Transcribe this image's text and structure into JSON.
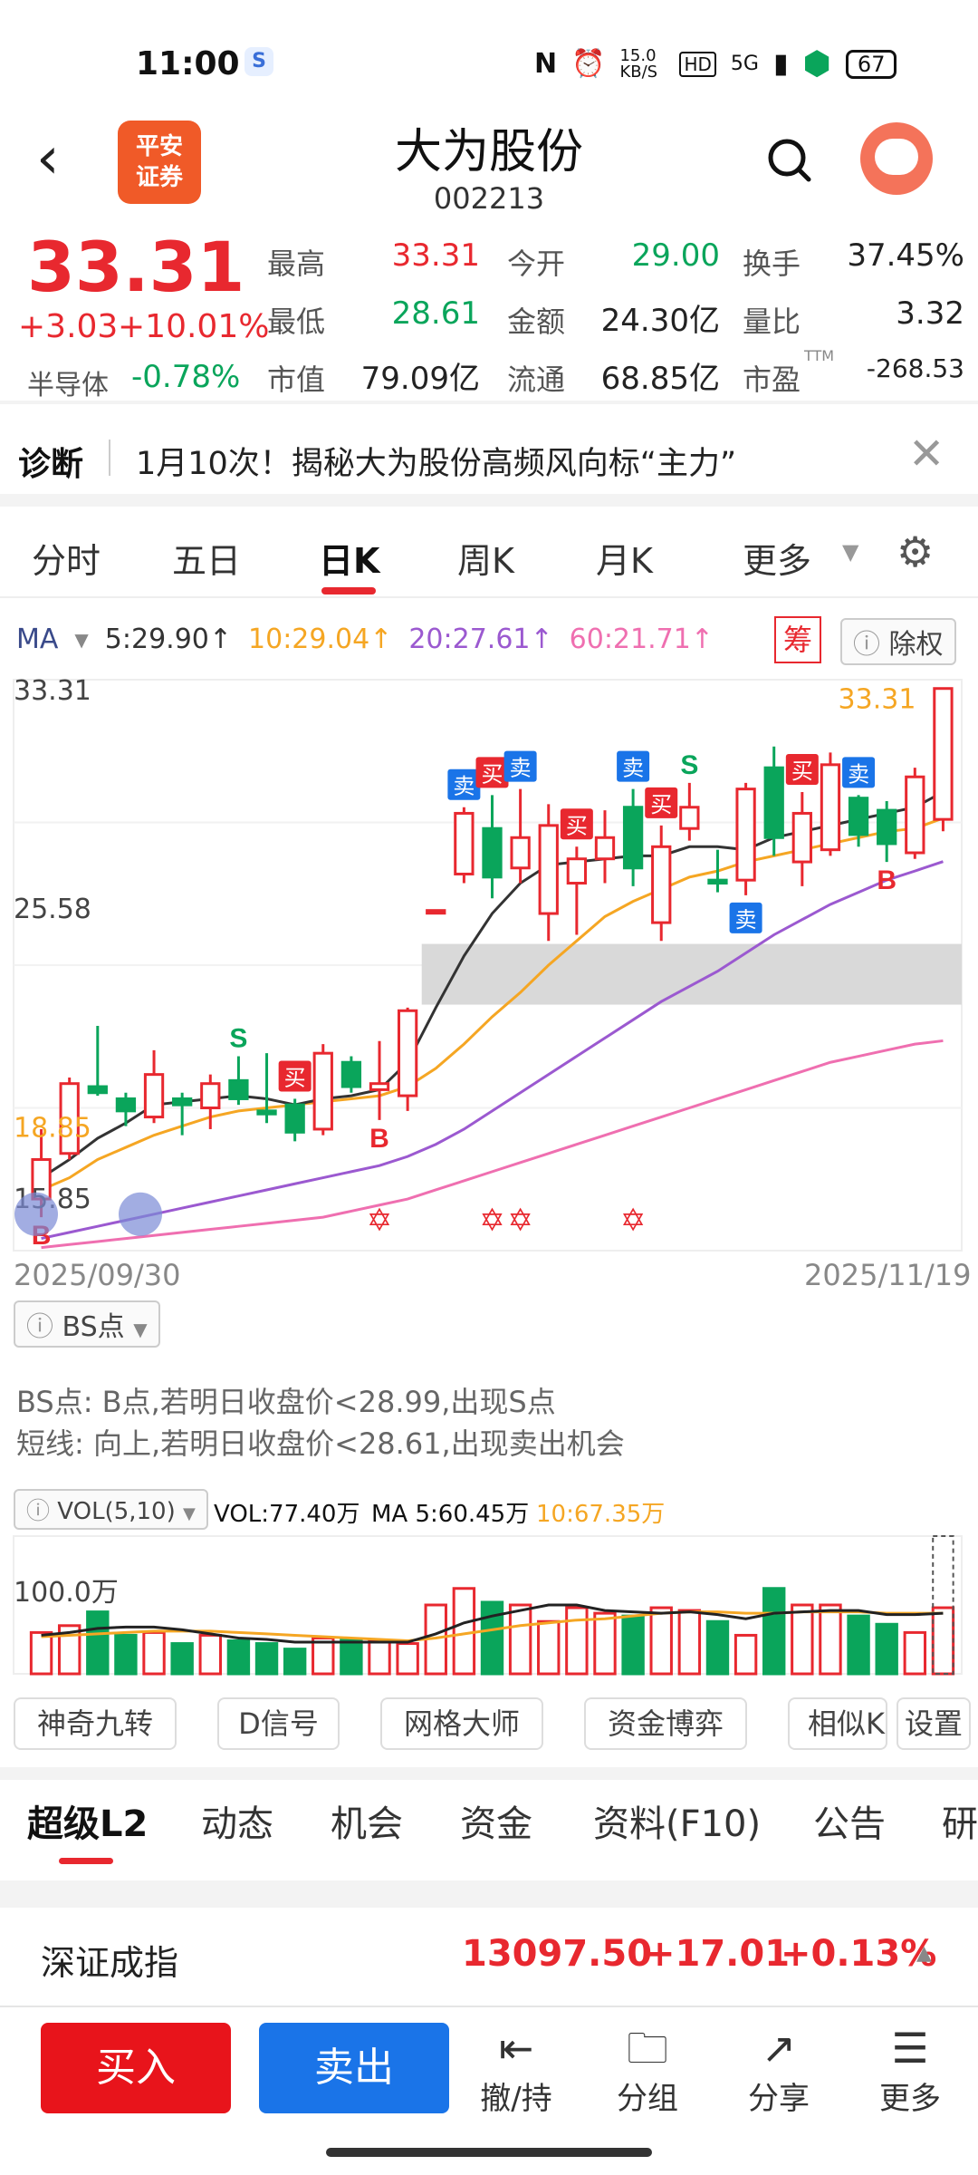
{
  "status": {
    "time": "11:00",
    "net_speed": "15.0 KB/S",
    "network": "5G",
    "battery": "67"
  },
  "header": {
    "logo_text": "平安\n证券",
    "stock_name": "大为股份",
    "stock_code": "002213"
  },
  "quote": {
    "price": "33.31",
    "change": "+3.03",
    "change_pct": "+10.01%",
    "sector_name": "半导体",
    "sector_change": "-0.78%",
    "rows": [
      [
        {
          "label": "最高",
          "value": "33.31",
          "color": "#e8282f"
        },
        {
          "label": "今开",
          "value": "29.00",
          "color": "#0aa55b"
        },
        {
          "label": "换手",
          "value": "37.45%",
          "color": "#222222"
        }
      ],
      [
        {
          "label": "最低",
          "value": "28.61",
          "color": "#0aa55b"
        },
        {
          "label": "金额",
          "value": "24.30亿",
          "color": "#222222"
        },
        {
          "label": "量比",
          "value": "3.32",
          "color": "#222222"
        }
      ],
      [
        {
          "label": "市值",
          "value": "79.09亿",
          "color": "#222222"
        },
        {
          "label": "流通",
          "value": "68.85亿",
          "color": "#222222"
        },
        {
          "label": "市盈",
          "value": "-268.53",
          "color": "#222222"
        }
      ]
    ],
    "pe_superscript": "TTM"
  },
  "diagnosis": {
    "label": "诊断",
    "text": "1月10次！揭秘大为股份高频风向标“主力”"
  },
  "chart_tabs": [
    "分时",
    "五日",
    "日K",
    "周K",
    "月K",
    "更多"
  ],
  "chart_tab_active": "日K",
  "ma_legend": {
    "label": "MA",
    "items": [
      {
        "text": "5:29.90↑",
        "color": "#333333"
      },
      {
        "text": "10:29.04↑",
        "color": "#f5a623"
      },
      {
        "text": "20:27.61↑",
        "color": "#9b59d0"
      },
      {
        "text": "60:21.71↑",
        "color": "#ef6fb0"
      }
    ],
    "chip_label": "筹",
    "exright_label": "除权"
  },
  "chart_data": {
    "type": "candlestick",
    "ylabels": {
      "top": "33.31",
      "mid": "25.58",
      "low_a": "18.85",
      "low_b": "15.85"
    },
    "x_start": "2025/09/30",
    "x_end": "2025/11/19",
    "last_price_label": "33.31",
    "candles": [
      {
        "o": 16.5,
        "c": 17.8,
        "h": 18.8,
        "l": 15.9
      },
      {
        "o": 18.0,
        "c": 20.3,
        "h": 20.5,
        "l": 17.8
      },
      {
        "o": 20.2,
        "c": 20.0,
        "h": 22.2,
        "l": 19.9
      },
      {
        "o": 19.8,
        "c": 19.4,
        "h": 20.0,
        "l": 18.9
      },
      {
        "o": 19.2,
        "c": 20.6,
        "h": 21.4,
        "l": 19.0
      },
      {
        "o": 19.8,
        "c": 19.6,
        "h": 20.0,
        "l": 18.6
      },
      {
        "o": 19.5,
        "c": 20.3,
        "h": 20.6,
        "l": 18.8
      },
      {
        "o": 20.4,
        "c": 19.8,
        "h": 21.2,
        "l": 19.6
      },
      {
        "o": 19.4,
        "c": 19.3,
        "h": 21.3,
        "l": 19.0
      },
      {
        "o": 19.6,
        "c": 18.7,
        "h": 19.8,
        "l": 18.4
      },
      {
        "o": 18.8,
        "c": 21.3,
        "h": 21.6,
        "l": 18.6
      },
      {
        "o": 21.0,
        "c": 20.2,
        "h": 21.2,
        "l": 20.0
      },
      {
        "o": 20.1,
        "c": 20.3,
        "h": 21.7,
        "l": 19.1
      },
      {
        "o": 19.9,
        "c": 22.7,
        "h": 22.8,
        "l": 19.4
      },
      {
        "o": 26.0,
        "c": 26.0,
        "h": 26.0,
        "l": 26.0
      },
      {
        "o": 27.2,
        "c": 29.2,
        "h": 29.4,
        "l": 26.9
      },
      {
        "o": 28.7,
        "c": 27.1,
        "h": 29.8,
        "l": 26.4
      },
      {
        "o": 27.4,
        "c": 28.4,
        "h": 30.0,
        "l": 26.9
      },
      {
        "o": 25.9,
        "c": 28.8,
        "h": 29.5,
        "l": 25.0
      },
      {
        "o": 26.9,
        "c": 27.7,
        "h": 28.1,
        "l": 25.2
      },
      {
        "o": 27.7,
        "c": 28.4,
        "h": 29.3,
        "l": 26.9
      },
      {
        "o": 29.4,
        "c": 27.4,
        "h": 30.0,
        "l": 26.8
      },
      {
        "o": 25.6,
        "c": 28.1,
        "h": 28.8,
        "l": 25.0
      },
      {
        "o": 28.7,
        "c": 29.4,
        "h": 30.2,
        "l": 28.3
      },
      {
        "o": 27.0,
        "c": 26.9,
        "h": 28.0,
        "l": 26.6
      },
      {
        "o": 27.0,
        "c": 30.0,
        "h": 30.2,
        "l": 26.5
      },
      {
        "o": 30.7,
        "c": 28.4,
        "h": 31.4,
        "l": 27.8
      },
      {
        "o": 27.6,
        "c": 29.2,
        "h": 29.9,
        "l": 26.8
      },
      {
        "o": 28.0,
        "c": 30.8,
        "h": 31.2,
        "l": 27.8
      },
      {
        "o": 29.7,
        "c": 28.5,
        "h": 29.8,
        "l": 28.1
      },
      {
        "o": 29.3,
        "c": 28.2,
        "h": 29.6,
        "l": 27.6
      },
      {
        "o": 27.9,
        "c": 30.4,
        "h": 30.7,
        "l": 27.7
      },
      {
        "o": 29.0,
        "c": 33.31,
        "h": 33.31,
        "l": 28.61
      }
    ],
    "ma5": [
      17.2,
      17.8,
      18.5,
      19.0,
      19.6,
      19.7,
      19.8,
      19.9,
      19.8,
      19.6,
      19.8,
      19.9,
      20.1,
      21.0,
      22.8,
      24.5,
      25.9,
      26.9,
      27.5,
      27.6,
      27.7,
      27.8,
      27.8,
      28.1,
      28.1,
      28.0,
      28.4,
      28.6,
      28.8,
      29.0,
      29.2,
      29.4,
      29.9
    ],
    "ma10": [
      16.8,
      17.2,
      17.8,
      18.2,
      18.6,
      18.9,
      19.2,
      19.4,
      19.5,
      19.6,
      19.7,
      19.8,
      19.9,
      20.2,
      20.8,
      21.6,
      22.5,
      23.3,
      24.2,
      25.0,
      25.8,
      26.3,
      26.7,
      27.1,
      27.3,
      27.6,
      27.8,
      28.0,
      28.2,
      28.4,
      28.6,
      28.7,
      29.04
    ],
    "ma20": [
      15.2,
      15.4,
      15.6,
      15.8,
      16.0,
      16.2,
      16.4,
      16.6,
      16.8,
      17.0,
      17.2,
      17.4,
      17.6,
      17.9,
      18.3,
      18.8,
      19.4,
      20.0,
      20.6,
      21.2,
      21.8,
      22.4,
      23.0,
      23.5,
      24.0,
      24.6,
      25.2,
      25.7,
      26.2,
      26.6,
      27.0,
      27.3,
      27.61
    ],
    "ma60": [
      14.9,
      15.0,
      15.1,
      15.2,
      15.3,
      15.4,
      15.5,
      15.6,
      15.7,
      15.8,
      15.9,
      16.1,
      16.3,
      16.5,
      16.8,
      17.1,
      17.4,
      17.7,
      18.0,
      18.3,
      18.6,
      18.9,
      19.2,
      19.5,
      19.8,
      20.1,
      20.4,
      20.7,
      21.0,
      21.2,
      21.4,
      21.6,
      21.71
    ],
    "signals": [
      {
        "i": 0,
        "label": "B",
        "pos": "below",
        "kind": "B"
      },
      {
        "i": 7,
        "label": "S",
        "pos": "above",
        "kind": "S"
      },
      {
        "i": 9,
        "label": "买",
        "pos": "above",
        "kind": "buy"
      },
      {
        "i": 12,
        "label": "B",
        "pos": "below",
        "kind": "B"
      },
      {
        "i": 15,
        "label": "卖",
        "pos": "above",
        "kind": "sell"
      },
      {
        "i": 16,
        "label": "买",
        "pos": "above",
        "kind": "buy"
      },
      {
        "i": 17,
        "label": "卖",
        "pos": "above",
        "kind": "sell"
      },
      {
        "i": 19,
        "label": "买",
        "pos": "above",
        "kind": "buy"
      },
      {
        "i": 21,
        "label": "卖",
        "pos": "above",
        "kind": "sell"
      },
      {
        "i": 22,
        "label": "买",
        "pos": "above",
        "kind": "buy"
      },
      {
        "i": 23,
        "label": "S",
        "pos": "above",
        "kind": "S"
      },
      {
        "i": 25,
        "label": "卖",
        "pos": "below",
        "kind": "sell"
      },
      {
        "i": 27,
        "label": "买",
        "pos": "above",
        "kind": "buy"
      },
      {
        "i": 29,
        "label": "卖",
        "pos": "above",
        "kind": "sell"
      },
      {
        "i": 30,
        "label": "B",
        "pos": "below",
        "kind": "B"
      }
    ],
    "stars_at": [
      12,
      16,
      17,
      21
    ],
    "volume": {
      "label": "VOL(5,10)",
      "vol_text": "VOL:77.40万",
      "ma5_text": "MA 5:60.45万",
      "ma10_text": "10:67.35万",
      "scale_label": "100.0万",
      "values": [
        30,
        35,
        45,
        28,
        30,
        22,
        28,
        24,
        22,
        18,
        26,
        25,
        24,
        22,
        50,
        62,
        52,
        50,
        38,
        48,
        44,
        42,
        48,
        46,
        38,
        28,
        62,
        50,
        50,
        42,
        36,
        30,
        48
      ],
      "ma5": [
        28,
        30,
        33,
        34,
        34,
        32,
        29,
        26,
        25,
        23,
        23,
        23,
        23,
        23,
        29,
        37,
        42,
        46,
        50,
        50,
        46,
        45,
        44,
        45,
        43,
        40,
        44,
        45,
        46,
        46,
        43,
        43,
        44
      ],
      "ma10": [
        27,
        28,
        29,
        30,
        31,
        31,
        31,
        30,
        29,
        28,
        27,
        26,
        25,
        24,
        26,
        29,
        32,
        35,
        37,
        39,
        40,
        42,
        44,
        45,
        45,
        44,
        44,
        45,
        45,
        45,
        44,
        44,
        44
      ]
    }
  },
  "indicator_panel": {
    "selector": "BS点",
    "line1": "BS点: B点,若明日收盘价<28.99,出现S点",
    "line2": "短线: 向上,若明日收盘价<28.61,出现卖出机会"
  },
  "tools": [
    "神奇九转",
    "D信号",
    "网格大师",
    "资金博弈",
    "相似K",
    "设置"
  ],
  "bottom_tabs": [
    "超级L2",
    "动态",
    "机会",
    "资金",
    "资料(F10)",
    "公告",
    "研"
  ],
  "index": {
    "name": "深证成指",
    "value": "13097.50",
    "change": "+17.01",
    "change_pct": "+0.13%"
  },
  "actions": {
    "buy": "买入",
    "sell": "卖出",
    "items": [
      {
        "label": "撤/持",
        "icon": "withdraw-icon"
      },
      {
        "label": "分组",
        "icon": "folder-icon"
      },
      {
        "label": "分享",
        "icon": "share-icon"
      },
      {
        "label": "更多",
        "icon": "menu-icon"
      }
    ]
  },
  "colors": {
    "up": "#e8282f",
    "down": "#0aa55b",
    "accent": "#e8282f",
    "sell_blue": "#1a74e8"
  }
}
